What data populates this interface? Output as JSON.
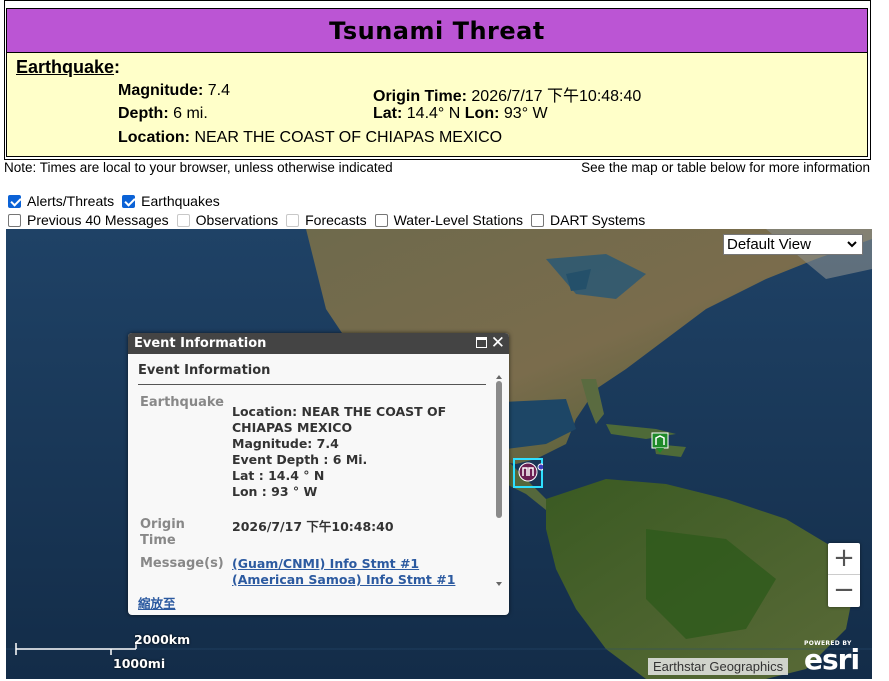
{
  "header": {
    "title": "Tsunami Threat"
  },
  "earthquake": {
    "heading": "Earthquake",
    "magnitude_label": "Magnitude:",
    "magnitude": "7.4",
    "origin_time_label": "Origin Time:",
    "origin_time": "2026/7/17 下午10:48:40",
    "depth_label": "Depth:",
    "depth": "6 mi.",
    "lat_label": "Lat:",
    "lat": "14.4° N",
    "lon_label": "Lon:",
    "lon": "93° W",
    "location_label": "Location:",
    "location": "NEAR THE COAST OF CHIAPAS MEXICO"
  },
  "notes": {
    "left": "Note: Times are local to your browser, unless otherwise indicated",
    "right": "See the map or table below for more information"
  },
  "layers": [
    {
      "label": "Alerts/Threats",
      "checked": true,
      "enabled": true
    },
    {
      "label": "Earthquakes",
      "checked": true,
      "enabled": true
    },
    {
      "label": "Previous 40 Messages",
      "checked": false,
      "enabled": true
    },
    {
      "label": "Observations",
      "checked": false,
      "enabled": false
    },
    {
      "label": "Forecasts",
      "checked": false,
      "enabled": false
    },
    {
      "label": "Water-Level Stations",
      "checked": false,
      "enabled": true
    },
    {
      "label": "DART Systems",
      "checked": false,
      "enabled": true
    }
  ],
  "map": {
    "view_select": "Default View",
    "zoom_in": "+",
    "zoom_out": "−",
    "scale_km": "2000km",
    "scale_mi": "1000mi",
    "attribution": "Earthstar Geographics",
    "esri_powered": "POWERED BY",
    "esri_word": "esri"
  },
  "popup": {
    "header": "Event Information",
    "title": "Event Information",
    "earthquake_key": "Earthquake",
    "details": [
      "Location: NEAR THE COAST OF",
      "CHIAPAS MEXICO",
      "Magnitude: 7.4",
      "Event Depth : 6 Mi.",
      "Lat : 14.4 ° N",
      "Lon : 93 ° W"
    ],
    "origin_key_1": "Origin",
    "origin_key_2": "Time",
    "origin_time": "2026/7/17 下午10:48:40",
    "messages_key": "Message(s)",
    "messages": [
      "(Guam/CNMI) Info Stmt #1",
      "(American Samoa) Info Stmt #1"
    ],
    "zoom_link": "縮放至"
  },
  "colors": {
    "title_bg": "#bb55d4",
    "info_bg": "#ffffc9",
    "checkbox": "#0b62d6",
    "link": "#2c5aa0"
  }
}
